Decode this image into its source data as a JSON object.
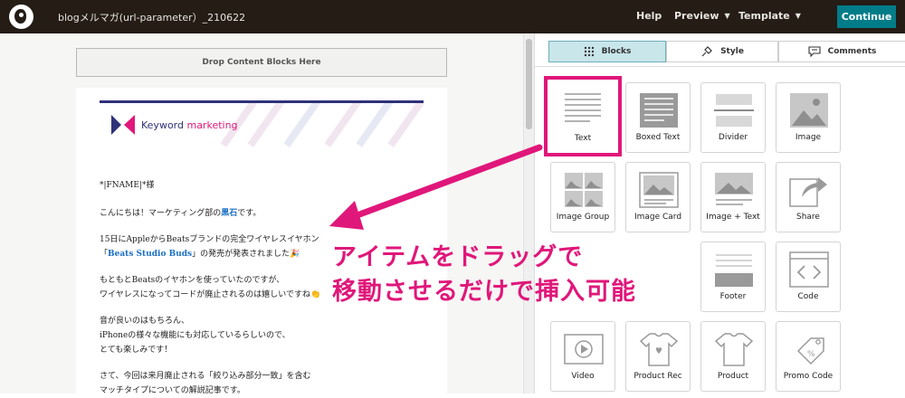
{
  "topbar": {
    "doc_title": "blogメルマガ(url-parameter）_210622",
    "help": "Help",
    "preview": "Preview",
    "template": "Template",
    "continue": "Continue"
  },
  "canvas": {
    "drop_zone": "Drop Content Blocks Here",
    "brand_word1": "Keyword",
    "brand_word2": " marketing",
    "lines": [
      "*|FNAME|*様",
      "こんにちは！マーケティング部の",
      "黒石",
      "です。",
      "15日にAppleからBeatsブランドの完全ワイヤレスイヤホン",
      "「",
      "Beats Studio Buds",
      "」の発売が発表されました🎉",
      "もともとBeatsのイヤホンを使っていたのですが、",
      "ワイヤレスになってコードが廃止されるのは嬉しいですね👏",
      "音が良いのはもちろん、",
      "iPhoneの様々な機能にも対応しているらしいので、",
      "とても楽しみです！",
      "さて、今回は来月廃止される「絞り込み部分一致」を含む",
      "マッチタイプについての解説記事です。"
    ]
  },
  "panel": {
    "tabs": [
      {
        "label": "Blocks",
        "icon": "grid-icon"
      },
      {
        "label": "Style",
        "icon": "style-brush-icon"
      },
      {
        "label": "Comments",
        "icon": "comment-icon"
      }
    ],
    "blocks": [
      {
        "label": "Text",
        "icon": "text-block-icon"
      },
      {
        "label": "Boxed Text",
        "icon": "boxed-text-icon"
      },
      {
        "label": "Divider",
        "icon": "divider-icon"
      },
      {
        "label": "Image",
        "icon": "image-icon"
      },
      {
        "label": "Image Group",
        "icon": "image-group-icon"
      },
      {
        "label": "Image Card",
        "icon": "image-card-icon"
      },
      {
        "label": "Image + Text",
        "icon": "image-text-icon"
      },
      {
        "label": "Share",
        "icon": "share-icon"
      },
      {
        "label": "Footer",
        "icon": "footer-icon"
      },
      {
        "label": "Code",
        "icon": "code-icon"
      },
      {
        "label": "Video",
        "icon": "video-icon"
      },
      {
        "label": "Product Rec",
        "icon": "product-rec-icon"
      },
      {
        "label": "Product",
        "icon": "product-icon"
      },
      {
        "label": "Promo Code",
        "icon": "promo-code-icon"
      }
    ]
  },
  "annotation": {
    "line1": "アイテムをドラッグで",
    "line2": "移動させるだけで挿入可能",
    "color": "#e0177a"
  },
  "colors": {
    "topbar": "#241c15",
    "accent": "#007c89",
    "tab_active": "#c9e6ea",
    "link": "#1a6fc4"
  }
}
